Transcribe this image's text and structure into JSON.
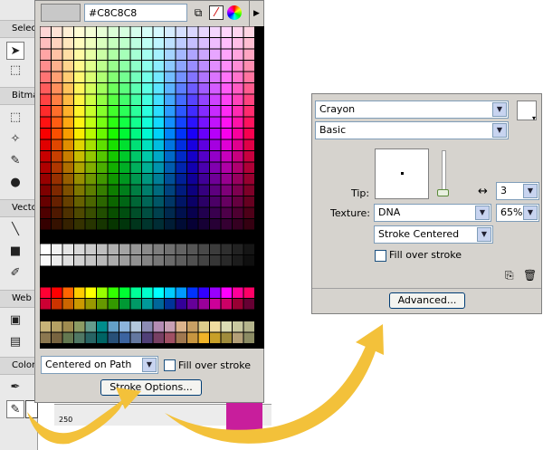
{
  "toolbar": {
    "sections": [
      "Select",
      "Bitmap",
      "Vector",
      "Web",
      "Colors"
    ],
    "tool_icons": [
      "pointer-icon",
      "subselect-icon",
      "marquee-icon",
      "lasso-icon",
      "magic-wand-icon",
      "pencil-icon",
      "blur-icon",
      "line-icon",
      "rectangle-icon",
      "freeform-icon",
      "hotspot-icon",
      "slice-icon",
      "eyedropper-icon",
      "stroke-color-icon"
    ]
  },
  "swatch_popup": {
    "hex_value": "#C8C8C8",
    "preview_color": "#C8C8C8",
    "stroke_placement": "Centered on Path",
    "fill_over_stroke_label": "Fill over stroke",
    "stroke_options_label": "Stroke Options...",
    "ruler_label": "250"
  },
  "stroke_panel": {
    "category": "Crayon",
    "style": "Basic",
    "tip_label": "Tip:",
    "tip_value": "3",
    "texture_label": "Texture:",
    "texture": "DNA",
    "texture_amount": "65%",
    "placement": "Stroke Centered",
    "fill_over_stroke_label": "Fill over stroke",
    "advanced_label": "Advanced..."
  },
  "colors": {
    "highlight_arrow": "#f3c13a",
    "panel_bg": "#d6d3ce"
  }
}
